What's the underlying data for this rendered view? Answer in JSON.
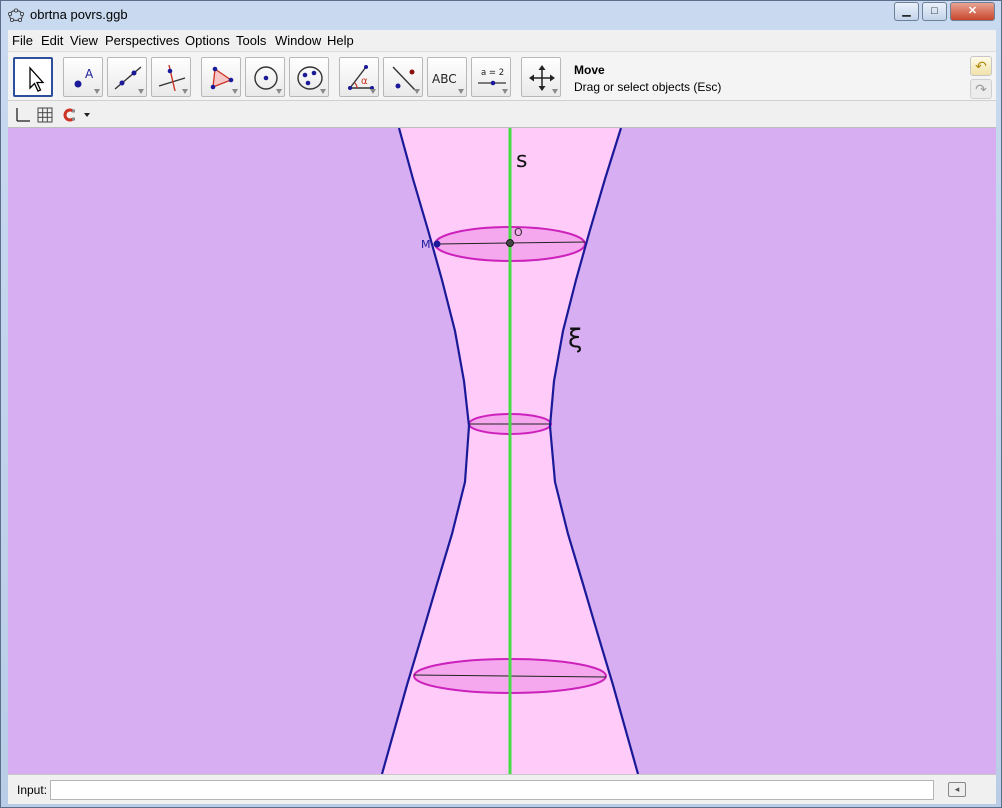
{
  "window": {
    "title": "obrtna povrs.ggb",
    "minimize_glyph": "▁",
    "maximize_glyph": "□",
    "close_glyph": "✕"
  },
  "menu": [
    "File",
    "Edit",
    "View",
    "Perspectives",
    "Options",
    "Tools",
    "Window",
    "Help"
  ],
  "toolbar": {
    "tools": [
      {
        "name": "move-tool",
        "icon": "arrow-pointer-icon",
        "active": true
      },
      {
        "name": "point-tool",
        "icon": "point-icon",
        "label": "A"
      },
      {
        "name": "line-tool",
        "icon": "line-through-points-icon"
      },
      {
        "name": "perpendicular-line-tool",
        "icon": "perpendicular-line-icon"
      },
      {
        "name": "polygon-tool",
        "icon": "polygon-icon"
      },
      {
        "name": "circle-tool",
        "icon": "circle-center-point-icon"
      },
      {
        "name": "conic-tool",
        "icon": "ellipse-icon"
      },
      {
        "name": "angle-tool",
        "icon": "angle-icon",
        "label": "α"
      },
      {
        "name": "reflect-tool",
        "icon": "reflect-about-line-icon"
      },
      {
        "name": "text-tool",
        "icon": "text-icon",
        "label": "ABC"
      },
      {
        "name": "slider-tool",
        "icon": "slider-icon",
        "label": "a = 2"
      },
      {
        "name": "move-graphics-view-tool",
        "icon": "move-view-cross-icon"
      }
    ],
    "current_tool_name": "Move",
    "current_tool_help": "Drag or select objects (Esc)",
    "undo_glyph": "↶",
    "redo_glyph": "↷"
  },
  "stylebar": {
    "icons": [
      "axes-icon",
      "grid-icon",
      "magnet-icon",
      "dropdown-arrow-icon"
    ]
  },
  "graphics": {
    "background_color": "#d7aef2",
    "surface_color": "#ffccfa",
    "axis_color": "#44dd44",
    "profile_color": "#1a1a99",
    "circle_color": "#cc22bb",
    "labels": {
      "axis": "s",
      "curve": "ξ",
      "point_M": "M",
      "point_O": "O"
    }
  },
  "input_bar": {
    "label": "Input:",
    "value": "",
    "help_glyph": "◂"
  }
}
